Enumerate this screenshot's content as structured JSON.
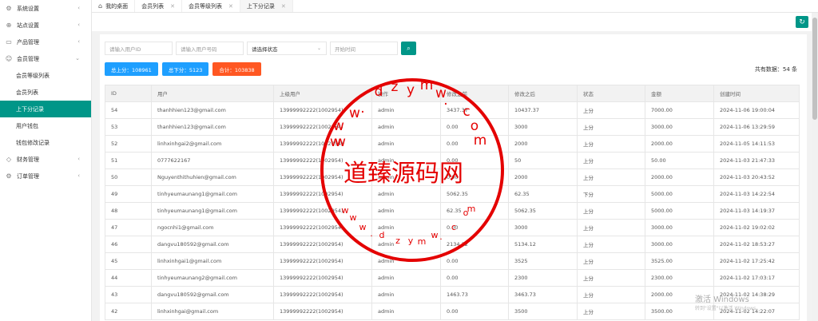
{
  "sidebar": {
    "items": [
      {
        "label": "系统设置",
        "icon": "gear-icon"
      },
      {
        "label": "站点设置",
        "icon": "globe-icon"
      },
      {
        "label": "产品管理",
        "icon": "folder-icon"
      },
      {
        "label": "会员管理",
        "icon": "user-icon"
      }
    ],
    "sub": [
      "会员等级列表",
      "会员列表",
      "上下分记录",
      "用户钱包",
      "钱包修改记录"
    ],
    "after": [
      {
        "label": "财务管理",
        "icon": "diamond-icon"
      },
      {
        "label": "订单管理",
        "icon": "gear-icon"
      }
    ]
  },
  "tabs": [
    {
      "label": "我的桌面"
    },
    {
      "label": "会员列表"
    },
    {
      "label": "会员等级列表"
    },
    {
      "label": "上下分记录"
    }
  ],
  "filters": {
    "user_id_placeholder": "请输入用户ID",
    "phone_placeholder": "请输入用户号码",
    "status_select": "请选择状态",
    "start_time_placeholder": "开始时间"
  },
  "badges": {
    "up": "总上分：108961",
    "down": "总下分：5123",
    "sum": "合计：103838"
  },
  "total": "共有数据：54 条",
  "table": {
    "headers": [
      "ID",
      "用户",
      "上级用户",
      "操作",
      "修改之前",
      "修改之后",
      "状态",
      "金额",
      "创建时间"
    ],
    "rows": [
      [
        "54",
        "thanhhien123@gmail.com",
        "13999992222(1002954)",
        "admin",
        "3437.37",
        "10437.37",
        "上分",
        "7000.00",
        "2024-11-06 19:00:04"
      ],
      [
        "53",
        "thanhhien123@gmail.com",
        "13999992222(1002954)",
        "admin",
        "0.00",
        "3000",
        "上分",
        "3000.00",
        "2024-11-06 13:29:59"
      ],
      [
        "52",
        "linhxinhgai2@gmail.com",
        "13999992222(1002954)",
        "admin",
        "0.00",
        "2000",
        "上分",
        "2000.00",
        "2024-11-05 14:11:53"
      ],
      [
        "51",
        "0777622167",
        "13999992222(1002954)",
        "admin",
        "0.00",
        "50",
        "上分",
        "50.00",
        "2024-11-03 21:47:33"
      ],
      [
        "50",
        "Nguyenthithuhien@gmail.com",
        "13999992222(1002954)",
        "admin",
        "0.00",
        "2000",
        "上分",
        "2000.00",
        "2024-11-03 20:43:52"
      ],
      [
        "49",
        "tinhyeumaunang1@gmail.com",
        "13999992222(1002954)",
        "admin",
        "5062.35",
        "62.35",
        "下分",
        "5000.00",
        "2024-11-03 14:22:54"
      ],
      [
        "48",
        "tinhyeumaunang1@gmail.com",
        "13999992222(1002954)",
        "admin",
        "62.35",
        "5062.35",
        "上分",
        "5000.00",
        "2024-11-03 14:19:37"
      ],
      [
        "47",
        "ngocnhi1@gmail.com",
        "13999992222(1002954)",
        "admin",
        "0.00",
        "3000",
        "上分",
        "3000.00",
        "2024-11-02 19:02:02"
      ],
      [
        "46",
        "dangvu180592@gmail.com",
        "13999992222(1002954)",
        "admin",
        "2134.12",
        "5134.12",
        "上分",
        "3000.00",
        "2024-11-02 18:53:27"
      ],
      [
        "45",
        "linhxinhgai1@gmail.com",
        "13999992222(1002954)",
        "admin",
        "0.00",
        "3525",
        "上分",
        "3525.00",
        "2024-11-02 17:25:42"
      ],
      [
        "44",
        "tinhyeumaunang2@gmail.com",
        "13999992222(1002954)",
        "admin",
        "0.00",
        "2300",
        "上分",
        "2300.00",
        "2024-11-02 17:03:17"
      ],
      [
        "43",
        "dangvu180592@gmail.com",
        "13999992222(1002954)",
        "admin",
        "1463.73",
        "3463.73",
        "上分",
        "2000.00",
        "2024-11-02 14:38:29"
      ],
      [
        "42",
        "linhxinhgai@gmail.com",
        "13999992222(1002954)",
        "admin",
        "0.00",
        "3500",
        "上分",
        "3500.00",
        "2024-11-02 14:22:07"
      ]
    ]
  },
  "watermark": {
    "main": "道臻源码网",
    "letters_top": [
      "w",
      ".",
      "d",
      "z",
      "y",
      "m",
      "w",
      ".",
      "c",
      "o",
      "m"
    ],
    "letters_bottom": [
      "w",
      "w",
      "w",
      ".",
      "d",
      "z",
      "y",
      "m",
      "w",
      ".",
      "c",
      "o",
      "m"
    ],
    "extra_w": [
      "w",
      "w",
      "w"
    ]
  },
  "os_notice": {
    "line1": "激活 Windows",
    "line2": "转到\"设置\"以激活 Windows。"
  },
  "colors": {
    "primary": "#009688",
    "blue": "#1e9fff",
    "orange": "#ff5722",
    "watermark": "#e40000"
  }
}
